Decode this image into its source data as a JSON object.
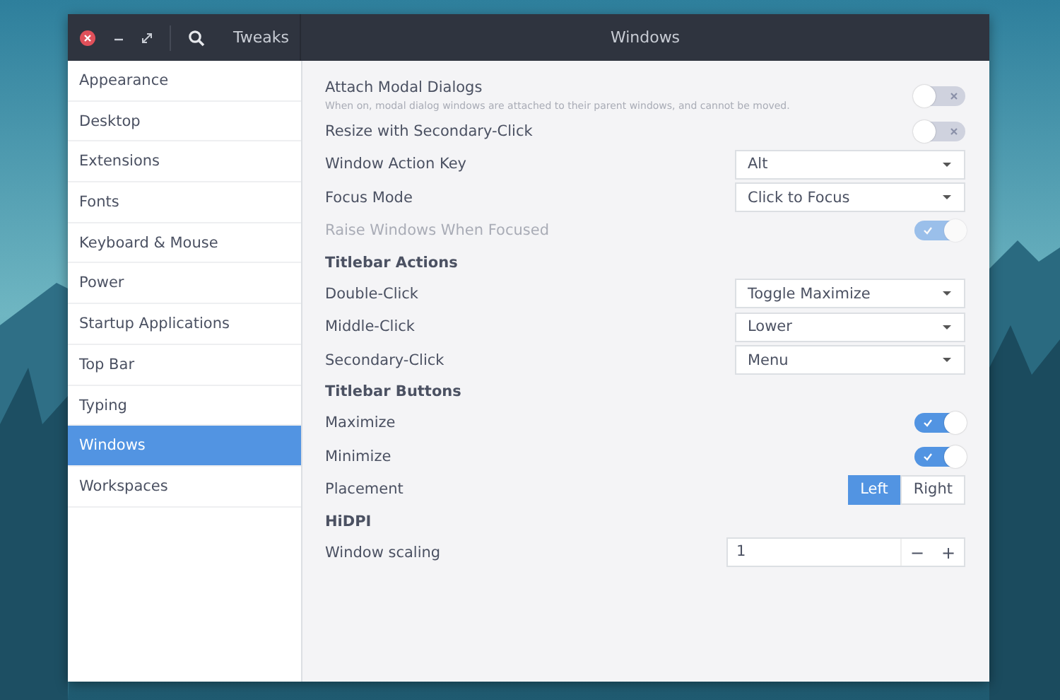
{
  "titlebar": {
    "app_title": "Tweaks",
    "page_title": "Windows"
  },
  "sidebar": {
    "items": [
      {
        "label": "Appearance",
        "selected": false
      },
      {
        "label": "Desktop",
        "selected": false
      },
      {
        "label": "Extensions",
        "selected": false
      },
      {
        "label": "Fonts",
        "selected": false
      },
      {
        "label": "Keyboard & Mouse",
        "selected": false
      },
      {
        "label": "Power",
        "selected": false
      },
      {
        "label": "Startup Applications",
        "selected": false
      },
      {
        "label": "Top Bar",
        "selected": false
      },
      {
        "label": "Typing",
        "selected": false
      },
      {
        "label": "Windows",
        "selected": true
      },
      {
        "label": "Workspaces",
        "selected": false
      }
    ]
  },
  "settings": [
    {
      "kind": "switch",
      "label": "Attach Modal Dialogs",
      "description": "When on, modal dialog windows are attached to their parent windows, and cannot be moved.",
      "on": false,
      "disabled": false
    },
    {
      "kind": "switch",
      "label": "Resize with Secondary-Click",
      "on": false,
      "disabled": false
    },
    {
      "kind": "dropdown",
      "label": "Window Action Key",
      "value": "Alt"
    },
    {
      "kind": "dropdown",
      "label": "Focus Mode",
      "value": "Click to Focus"
    },
    {
      "kind": "switch",
      "label": "Raise Windows When Focused",
      "on": true,
      "disabled": true
    },
    {
      "kind": "heading",
      "label": "Titlebar Actions"
    },
    {
      "kind": "dropdown",
      "label": "Double-Click",
      "value": "Toggle Maximize"
    },
    {
      "kind": "dropdown",
      "label": "Middle-Click",
      "value": "Lower"
    },
    {
      "kind": "dropdown",
      "label": "Secondary-Click",
      "value": "Menu"
    },
    {
      "kind": "heading",
      "label": "Titlebar Buttons"
    },
    {
      "kind": "switch",
      "label": "Maximize",
      "on": true,
      "disabled": false
    },
    {
      "kind": "switch",
      "label": "Minimize",
      "on": true,
      "disabled": false
    },
    {
      "kind": "segmented",
      "label": "Placement",
      "options": [
        {
          "label": "Left",
          "selected": true
        },
        {
          "label": "Right",
          "selected": false
        }
      ]
    },
    {
      "kind": "heading",
      "label": "HiDPI"
    },
    {
      "kind": "spin",
      "label": "Window scaling",
      "value": "1",
      "decrement": "−",
      "increment": "+"
    }
  ]
}
